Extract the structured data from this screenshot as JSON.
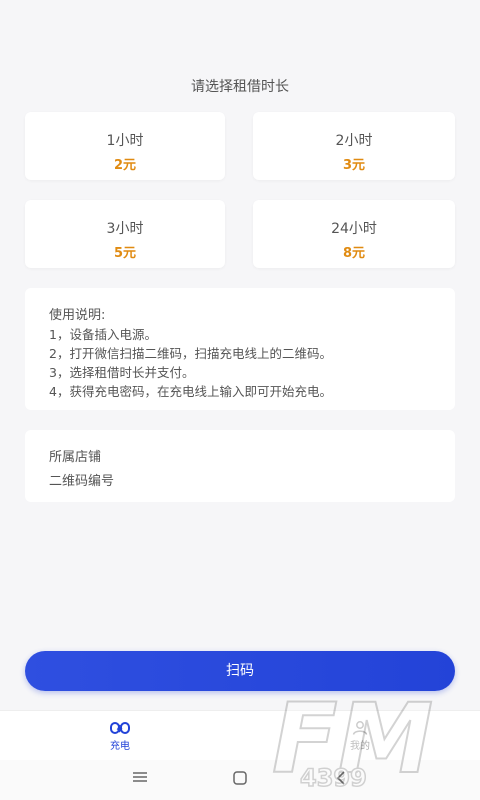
{
  "page": {
    "title": "请选择租借时长"
  },
  "options": [
    {
      "duration": "1小时",
      "price": "2元"
    },
    {
      "duration": "2小时",
      "price": "3元"
    },
    {
      "duration": "3小时",
      "price": "5元"
    },
    {
      "duration": "24小时",
      "price": "8元"
    }
  ],
  "instructions": {
    "title": "使用说明:",
    "steps": [
      "1，设备插入电源。",
      "2，打开微信扫描二维码，扫描充电线上的二维码。",
      "3，选择租借时长并支付。",
      "4，获得充电密码，在充电线上输入即可开始充电。"
    ]
  },
  "store": {
    "shop_label": "所属店铺",
    "qr_label": "二维码编号"
  },
  "scan_button": "扫码",
  "tabs": [
    {
      "label": "充电",
      "icon": "charge-icon",
      "active": true
    },
    {
      "label": "我的",
      "icon": "user-icon",
      "active": false
    }
  ],
  "colors": {
    "accent": "#2343d8",
    "price": "#e08b12"
  },
  "watermark": {
    "text": "FM",
    "sub": "4399"
  }
}
